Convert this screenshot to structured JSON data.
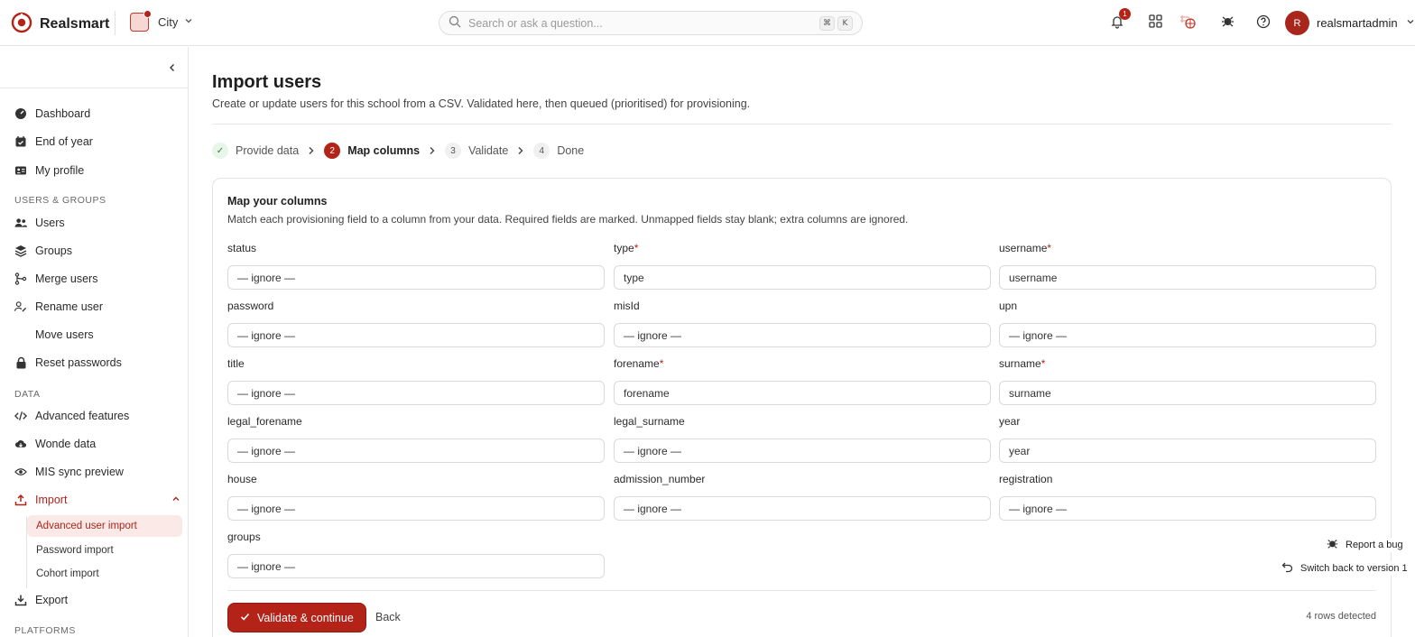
{
  "header": {
    "brand": "Realsmart",
    "school": "City",
    "search_placeholder": "Search or ask a question...",
    "kbd_cmd": "⌘",
    "kbd_k": "K",
    "notifications_count": "1",
    "user_initial": "R",
    "user_name": "realsmartadmin"
  },
  "sidebar": {
    "items_top": [
      "Dashboard",
      "End of year",
      "My profile"
    ],
    "section_users": "USERS & GROUPS",
    "items_users": [
      "Users",
      "Groups",
      "Merge users",
      "Rename user",
      "Move users",
      "Reset passwords"
    ],
    "section_data": "DATA",
    "items_data": [
      "Advanced features",
      "Wonde data",
      "MIS sync preview"
    ],
    "import_label": "Import",
    "import_sub": [
      "Advanced user import",
      "Password import",
      "Cohort import"
    ],
    "export_label": "Export",
    "section_platforms": "PLATFORMS"
  },
  "page": {
    "title": "Import users",
    "subtitle": "Create or update users for this school from a CSV. Validated here, then queued (prioritised) for provisioning."
  },
  "steps": [
    {
      "num": "✓",
      "label": "Provide data"
    },
    {
      "num": "2",
      "label": "Map columns"
    },
    {
      "num": "3",
      "label": "Validate"
    },
    {
      "num": "4",
      "label": "Done"
    }
  ],
  "card": {
    "title": "Map your columns",
    "description": "Match each provisioning field to a column from your data. Required fields are marked. Unmapped fields stay blank; extra columns are ignored.",
    "required_mark": "*",
    "fields": [
      {
        "label": "status",
        "value": "— ignore —"
      },
      {
        "label": "type",
        "value": "type"
      },
      {
        "label": "username",
        "value": "username"
      },
      {
        "label": "password",
        "value": "— ignore —"
      },
      {
        "label": "misId",
        "value": "— ignore —"
      },
      {
        "label": "upn",
        "value": "— ignore —"
      },
      {
        "label": "title",
        "value": "— ignore —"
      },
      {
        "label": "forename",
        "value": "forename"
      },
      {
        "label": "surname",
        "value": "surname"
      },
      {
        "label": "legal_forename",
        "value": "— ignore —"
      },
      {
        "label": "legal_surname",
        "value": "— ignore —"
      },
      {
        "label": "year",
        "value": "year"
      },
      {
        "label": "house",
        "value": "— ignore —"
      },
      {
        "label": "admission_number",
        "value": "— ignore —"
      },
      {
        "label": "registration",
        "value": "— ignore —"
      },
      {
        "label": "groups",
        "value": "— ignore —"
      }
    ],
    "primary_button": "Validate & continue",
    "back_button": "Back",
    "rows_detected": "4 rows detected"
  },
  "floating": {
    "report_bug": "Report a bug",
    "switch_version": "Switch back to version 1"
  },
  "colors": {
    "accent": "#b42318",
    "accent_light": "#fbe9e7"
  }
}
